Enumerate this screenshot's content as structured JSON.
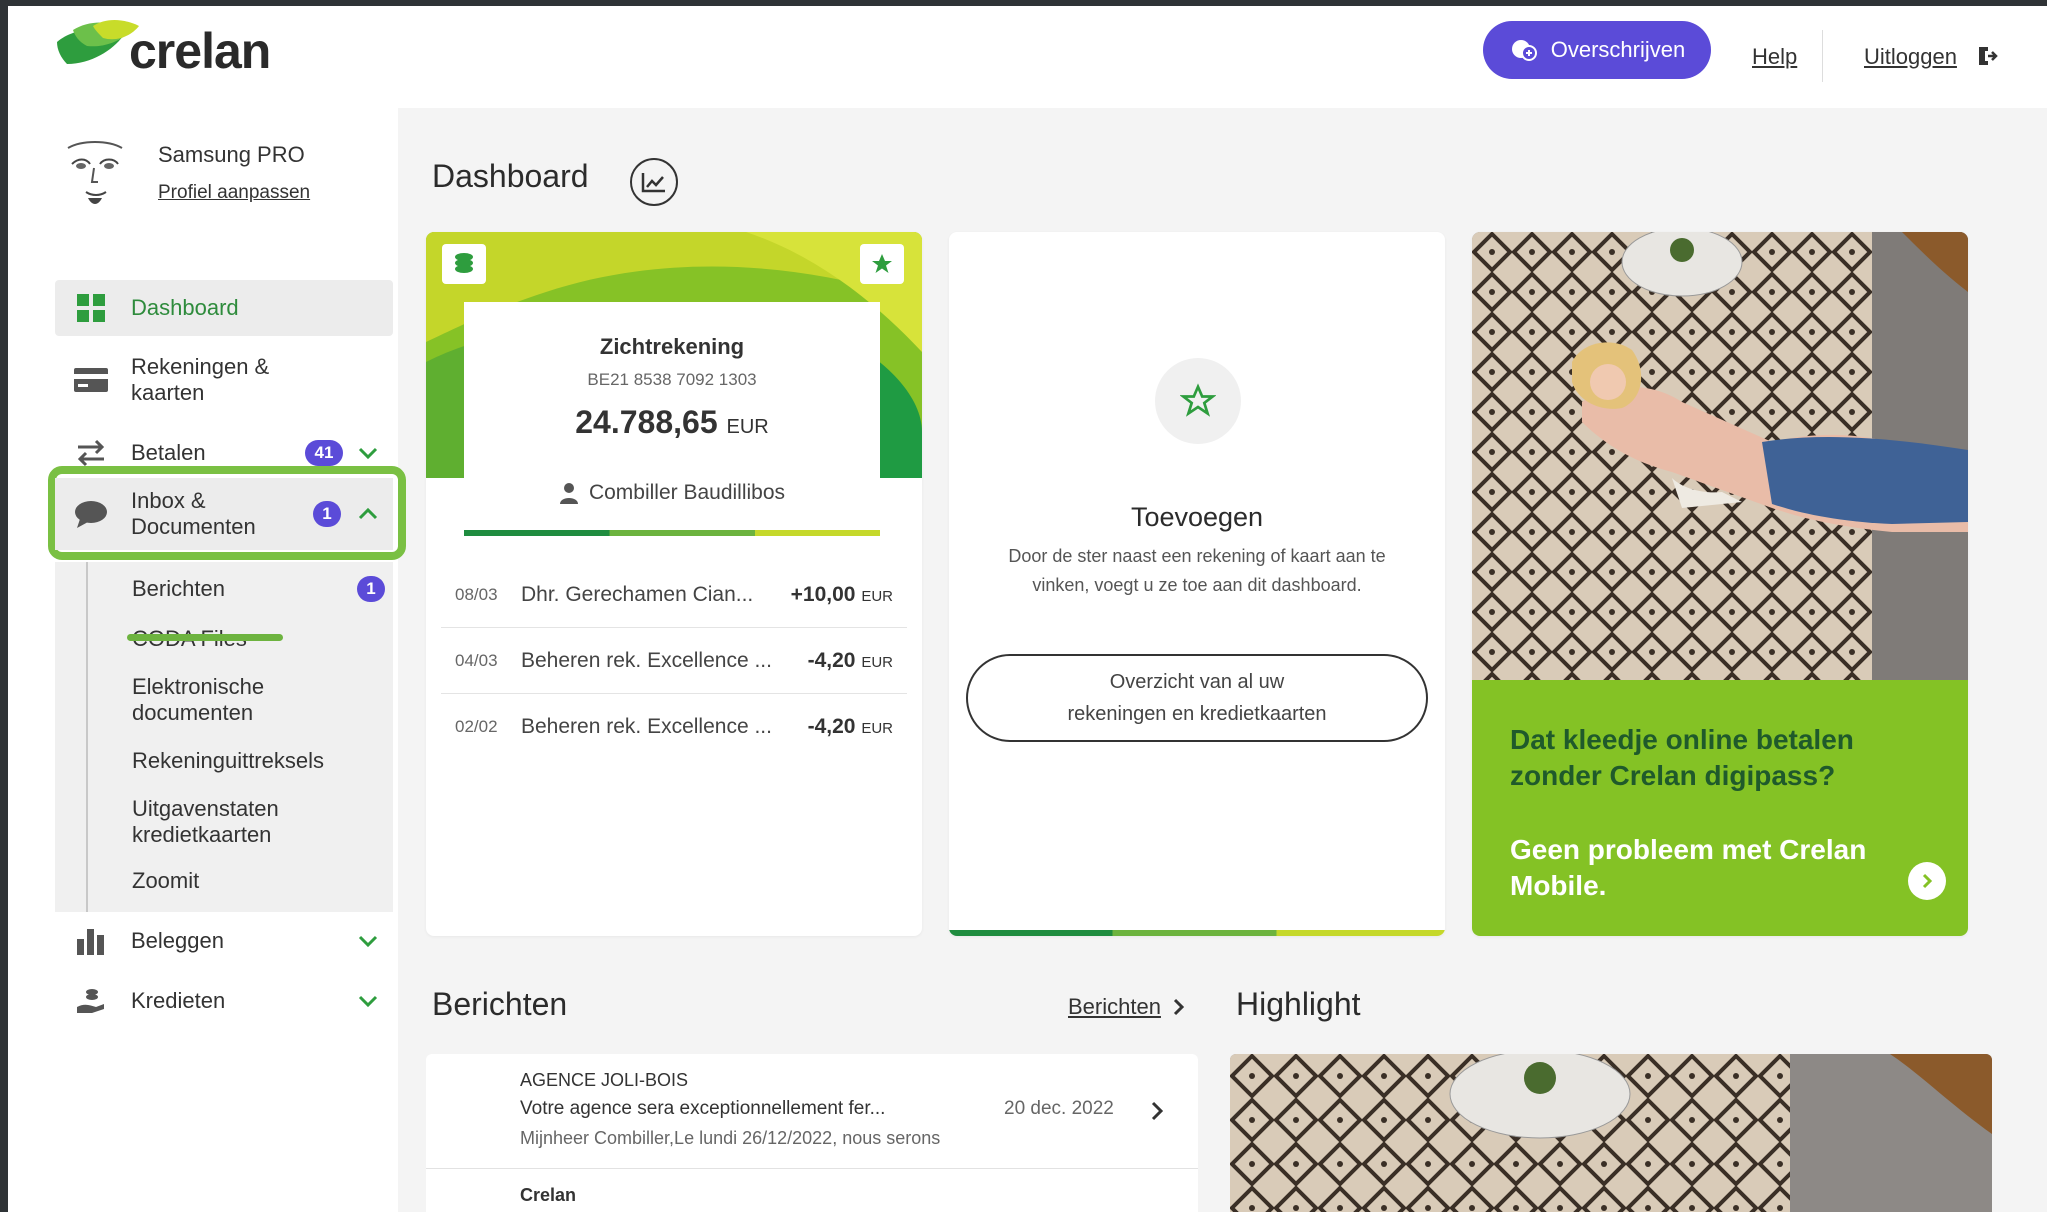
{
  "header": {
    "brand": "crelan",
    "transfer_label": "Overschrijven",
    "help_label": "Help",
    "logout_label": "Uitloggen"
  },
  "profile": {
    "name": "Samsung PRO",
    "edit_link": "Profiel aanpassen"
  },
  "sidebar": {
    "items": [
      {
        "label": "Dashboard",
        "icon": "grid-icon"
      },
      {
        "label_line1": "Rekeningen &",
        "label_line2": "kaarten",
        "icon": "card-icon"
      },
      {
        "label": "Betalen",
        "badge": "41",
        "icon": "transfer-arrows-icon"
      },
      {
        "label_line1": "Inbox &",
        "label_line2": "Documenten",
        "badge": "1",
        "icon": "chat-bubble-icon"
      },
      {
        "label": "Beleggen",
        "icon": "bar-chart-icon"
      },
      {
        "label": "Kredieten",
        "icon": "hand-coin-icon"
      }
    ],
    "submenu": [
      {
        "label": "Berichten",
        "badge": "1"
      },
      {
        "label": "CODA Files"
      },
      {
        "label_line1": "Elektronische",
        "label_line2": "documenten"
      },
      {
        "label": "Rekeninguittreksels"
      },
      {
        "label_line1": "Uitgavenstaten",
        "label_line2": "kredietkaarten"
      },
      {
        "label": "Zoomit"
      }
    ]
  },
  "main": {
    "title": "Dashboard",
    "account": {
      "name": "Zichtrekening",
      "iban": "BE21 8538 7092 1303",
      "balance": "24.788,65",
      "currency": "EUR",
      "owner": "Combiller Baudillibos",
      "transactions": [
        {
          "date": "08/03",
          "desc": "Dhr. Gerechamen Cian...",
          "amount": "+10,00",
          "currency": "EUR"
        },
        {
          "date": "04/03",
          "desc": "Beheren rek. Excellence ...",
          "amount": "-4,20",
          "currency": "EUR"
        },
        {
          "date": "02/02",
          "desc": "Beheren rek. Excellence ...",
          "amount": "-4,20",
          "currency": "EUR"
        }
      ]
    },
    "add": {
      "title": "Toevoegen",
      "description": "Door de ster naast een rekening of kaart aan te vinken, voegt u ze toe aan dit dashboard.",
      "button_line1": "Overzicht van al uw",
      "button_line2": "rekeningen en kredietkaarten"
    },
    "promo": {
      "headline": "Dat kleedje online betalen zonder Crelan digipass?",
      "subline": "Geen probleem met Crelan Mobile."
    },
    "messages": {
      "title": "Berichten",
      "link": "Berichten",
      "items": [
        {
          "sender": "AGENCE JOLI-BOIS",
          "subject": "Votre agence sera exceptionnellement fer...",
          "preview": "Mijnheer Combiller,Le lundi 26/12/2022, nous serons",
          "date": "20 dec. 2022"
        },
        {
          "sender": "Crelan"
        }
      ]
    },
    "highlight": {
      "title": "Highlight"
    }
  },
  "colors": {
    "accent_purple": "#5b4bd8",
    "brand_green": "#2e8b3c",
    "promo_green": "#84c225",
    "highlight_outline": "#7ac043"
  }
}
